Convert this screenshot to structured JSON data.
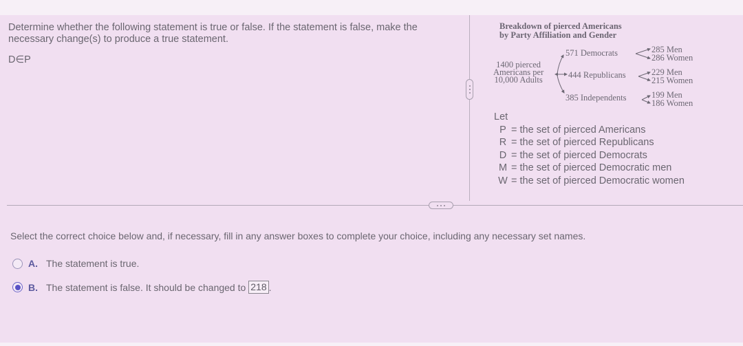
{
  "question": {
    "prompt": "Determine whether the following statement is true or false. If the statement is false, make the necessary change(s) to produce a true statement.",
    "statement": "D∈P"
  },
  "diagram": {
    "title_line1": "Breakdown of pierced Americans",
    "title_line2": "by Party Affiliation and Gender",
    "root": [
      "1400 pierced",
      "Americans per",
      "10,000 Adults"
    ],
    "parties": [
      {
        "label": "571 Democrats",
        "men": "285 Men",
        "women": "286 Women"
      },
      {
        "label": "444 Republicans",
        "men": "229 Men",
        "women": "215 Women"
      },
      {
        "label": "385 Independents",
        "men": "199 Men",
        "women": "186 Women"
      }
    ]
  },
  "definitions": {
    "intro": "Let",
    "items": [
      {
        "symbol": "P",
        "eq": "=",
        "text": "the set of pierced Americans"
      },
      {
        "symbol": "R",
        "eq": "=",
        "text": "the set of pierced Republicans"
      },
      {
        "symbol": "D",
        "eq": "=",
        "text": "the set of pierced Democrats"
      },
      {
        "symbol": "M",
        "eq": "=",
        "text": "the set of pierced Democratic men"
      },
      {
        "symbol": "W",
        "eq": "=",
        "text": "the set of pierced Democratic women"
      }
    ]
  },
  "instruction": "Select the correct choice below and, if necessary, fill in any answer boxes to complete your choice, including any necessary set names.",
  "choices": [
    {
      "letter": "A.",
      "text": "The statement is true.",
      "selected": false
    },
    {
      "letter": "B.",
      "text": "The statement is false. It should be changed to",
      "answer": "218",
      "suffix": ".",
      "selected": true
    }
  ],
  "icons": {
    "vertical_handle": "more-vertical-icon",
    "horizontal_handle": "more-horizontal-icon"
  }
}
